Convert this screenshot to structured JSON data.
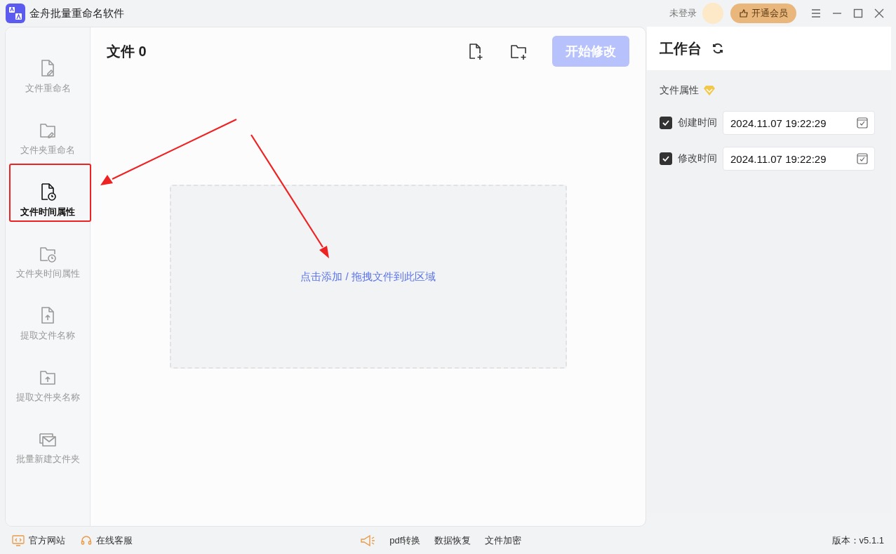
{
  "window": {
    "title": "金舟批量重命名软件",
    "login": "未登录",
    "vip_button": "开通会员"
  },
  "sidebar": {
    "items": [
      {
        "label": "文件重命名",
        "kind": "file-edit",
        "selected": false
      },
      {
        "label": "文件夹重命名",
        "kind": "folder-edit",
        "selected": false
      },
      {
        "label": "文件时间属性",
        "kind": "file-clock",
        "selected": true
      },
      {
        "label": "文件夹时间属性",
        "kind": "folder-clock",
        "selected": false
      },
      {
        "label": "提取文件名称",
        "kind": "file-up",
        "selected": false
      },
      {
        "label": "提取文件夹名称",
        "kind": "folder-up",
        "selected": false
      },
      {
        "label": "批量新建文件夹",
        "kind": "mail-stack",
        "selected": false
      }
    ]
  },
  "files": {
    "title": "文件",
    "count": "0",
    "start_button": {
      "label": "开始修改",
      "disabled": true
    },
    "drop_zone": "点击添加 / 拖拽文件到此区域"
  },
  "workbench": {
    "title": "工作台",
    "section": "文件属性",
    "fields": [
      {
        "label": "创建时间",
        "checked": true,
        "value": "2024.11.07 19:22:29"
      },
      {
        "label": "修改时间",
        "checked": true,
        "value": "2024.11.07 19:22:29"
      }
    ]
  },
  "status_bar": {
    "left": [
      "官方网站",
      "在线客服"
    ],
    "center": [
      "pdf转换",
      "数据恢复",
      "文件加密"
    ],
    "version": "版本：v5.1.1"
  }
}
